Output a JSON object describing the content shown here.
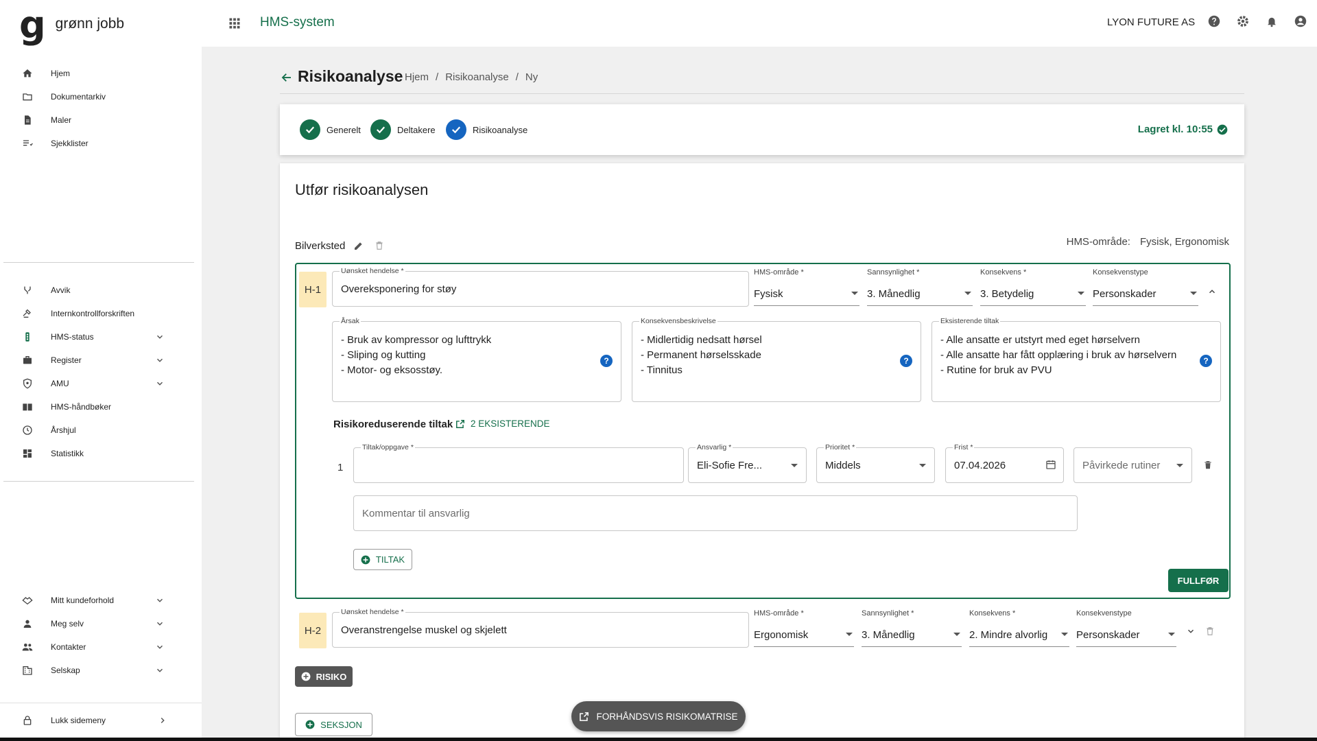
{
  "brand": {
    "logo_letter": "g",
    "name": "grønn jobb"
  },
  "topbar": {
    "app_name": "HMS-system",
    "company": "LYON FUTURE AS"
  },
  "sidebar": {
    "items_top": [
      {
        "label": "Hjem",
        "icon": "home-icon"
      },
      {
        "label": "Dokumentarkiv",
        "icon": "folder-icon"
      },
      {
        "label": "Maler",
        "icon": "document-icon"
      },
      {
        "label": "Sjekklister",
        "icon": "checklist-icon"
      }
    ],
    "items_mid": [
      {
        "label": "Avvik",
        "icon": "branch-icon"
      },
      {
        "label": "Internkontrollforskriften",
        "icon": "gavel-icon"
      },
      {
        "label": "HMS-status",
        "icon": "traffic-light-icon"
      },
      {
        "label": "Register",
        "icon": "briefcase-icon"
      },
      {
        "label": "AMU",
        "icon": "shield-icon"
      },
      {
        "label": "HMS-håndbøker",
        "icon": "book-icon"
      },
      {
        "label": "Årshjul",
        "icon": "clock-icon"
      },
      {
        "label": "Statistikk",
        "icon": "dashboard-icon"
      }
    ],
    "items_bottom": [
      {
        "label": "Mitt kundeforhold",
        "icon": "handshake-icon"
      },
      {
        "label": "Meg selv",
        "icon": "person-icon"
      },
      {
        "label": "Kontakter",
        "icon": "people-icon"
      },
      {
        "label": "Selskap",
        "icon": "building-icon"
      }
    ],
    "close_label": "Lukk sidemeny"
  },
  "page": {
    "title": "Risikoanalyse",
    "breadcrumb": [
      "Hjem",
      "/",
      "Risikoanalyse",
      "/",
      "Ny"
    ]
  },
  "steps": [
    "Generelt",
    "Deltakere",
    "Risikoanalyse"
  ],
  "saved_label": "Lagret kl. 10:55",
  "card": {
    "title": "Utfør risikoanalysen",
    "section_name": "Bilverksted",
    "hms_area_key": "HMS-område:",
    "hms_area_value": "Fysisk, Ergonomisk"
  },
  "hazard1": {
    "badge": "H-1",
    "event_label": "Uønsket hendelse *",
    "event_value": "Overeksponering for støy",
    "area_label": "HMS-område *",
    "area_value": "Fysisk",
    "prob_label": "Sannsynlighet *",
    "prob_value": "3. Månedlig",
    "cons_label": "Konsekvens *",
    "cons_value": "3. Betydelig",
    "type_label": "Konsekvenstype",
    "type_value": "Personskader",
    "cause_label": "Årsak",
    "cause_lines": [
      "- Bruk av kompressor og lufttrykk",
      "- Sliping og kutting",
      "- Motor- og eksosstøy."
    ],
    "desc_label": "Konsekvensbeskrivelse",
    "desc_lines": [
      "- Midlertidig nedsatt hørsel",
      "- Permanent hørselsskade",
      "- Tinnitus"
    ],
    "existing_label": "Eksisterende tiltak",
    "existing_lines": [
      "- Alle ansatte er utstyrt med eget hørselvern",
      "- Alle ansatte har fått opplæring i bruk av hørselvern",
      "- Rutine for bruk av PVU"
    ],
    "help_symbol": "?",
    "measures_title": "Risikoreduserende tiltak",
    "existing_link": "2 EKSISTERENDE",
    "row_number": "1",
    "task_label": "Tiltak/oppgave *",
    "task_value": "",
    "resp_label": "Ansvarlig *",
    "resp_value": "Eli-Sofie Fre...",
    "priority_label": "Prioritet *",
    "priority_value": "Middels",
    "deadline_label": "Frist *",
    "deadline_value": "07.04.2026",
    "routines_placeholder": "Påvirkede rutiner",
    "comment_placeholder": "Kommentar til ansvarlig",
    "add_measure": "TILTAK",
    "finish": "FULLFØR"
  },
  "hazard2": {
    "badge": "H-2",
    "event_label": "Uønsket hendelse *",
    "event_value": "Overanstrengelse muskel og skjelett",
    "area_label": "HMS-område *",
    "area_value": "Ergonomisk",
    "prob_label": "Sannsynlighet *",
    "prob_value": "3. Månedlig",
    "cons_label": "Konsekvens *",
    "cons_value": "2. Mindre alvorlig",
    "type_label": "Konsekvenstype",
    "type_value": "Personskader"
  },
  "buttons": {
    "add_risk": "RISIKO",
    "add_section": "SEKSJON",
    "preview": "FORHÅNDSVIS RISIKOMATRISE"
  },
  "colors": {
    "brand_green": "#156f4b",
    "step_blue": "#1565c0",
    "badge_yellow": "#fce9b8"
  }
}
